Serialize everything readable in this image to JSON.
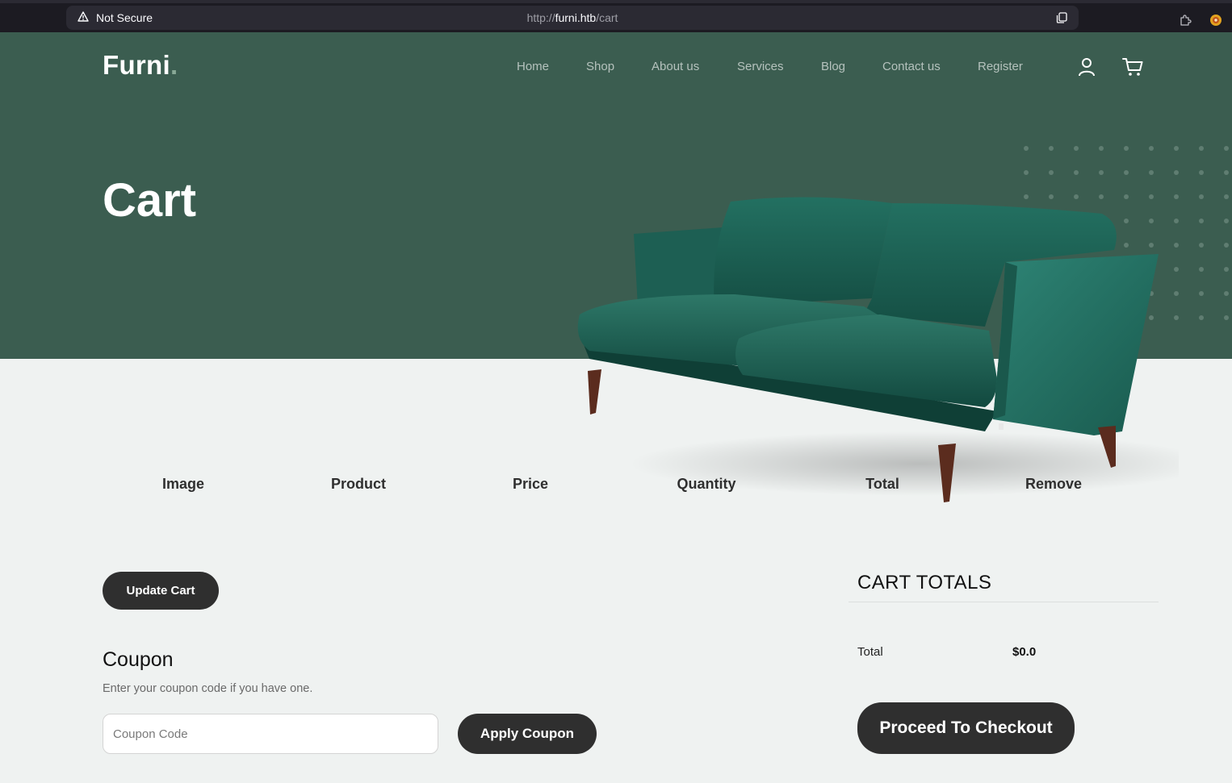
{
  "browser": {
    "security_label": "Not Secure",
    "url_scheme": "http://",
    "url_host": "furni.htb",
    "url_path": "/cart"
  },
  "site": {
    "logo_text": "Furni",
    "logo_dot": ".",
    "nav": [
      {
        "label": "Home"
      },
      {
        "label": "Shop"
      },
      {
        "label": "About us"
      },
      {
        "label": "Services"
      },
      {
        "label": "Blog"
      },
      {
        "label": "Contact us"
      },
      {
        "label": "Register"
      }
    ],
    "icons": [
      "user-icon",
      "cart-icon"
    ]
  },
  "hero": {
    "title": "Cart"
  },
  "cart_table": {
    "headers": [
      "Image",
      "Product",
      "Price",
      "Quantity",
      "Total",
      "Remove"
    ],
    "rows": []
  },
  "actions": {
    "update_cart_label": "Update Cart"
  },
  "coupon": {
    "title": "Coupon",
    "description": "Enter your coupon code if you have one.",
    "input_value": "",
    "input_placeholder": "Coupon Code",
    "apply_label": "Apply Coupon"
  },
  "totals": {
    "title": "CART TOTALS",
    "total_label": "Total",
    "total_value": "$0.0",
    "checkout_label": "Proceed To Checkout"
  },
  "colors": {
    "hero_bg": "#3b5d50",
    "page_bg": "#eff2f1",
    "button_bg": "#2f2f2f",
    "logo_dot": "#88a896"
  }
}
